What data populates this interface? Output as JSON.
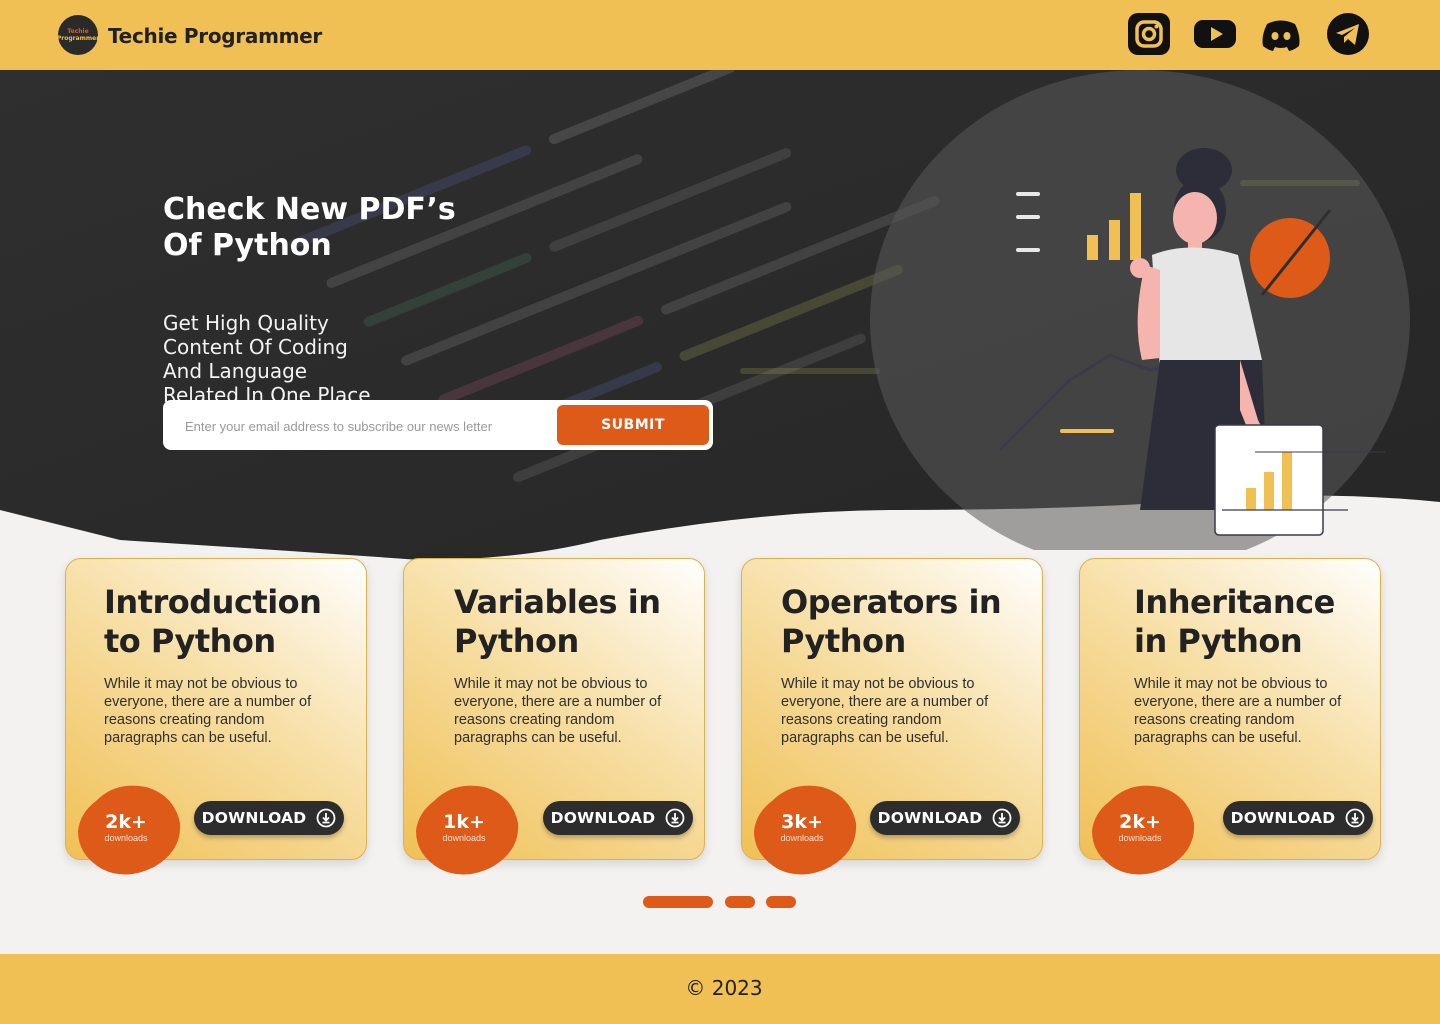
{
  "header": {
    "logo_text_line1": "Techie",
    "logo_text_line2": "Programmer",
    "brand": "Techie Programmer",
    "social": [
      "instagram-icon",
      "youtube-icon",
      "discord-icon",
      "telegram-icon"
    ]
  },
  "hero": {
    "title_line1": "Check New PDF’s",
    "title_line2": "Of  Python",
    "subtitle": [
      "Get High Quality",
      "Content Of Coding",
      "And Language",
      "Related In One Place"
    ],
    "email_placeholder": "Enter your email address to subscribe our news letter",
    "submit_label": "SUBMIT"
  },
  "cards": [
    {
      "title": "Introduction to Python",
      "body": "While it may not be obvious to everyone, there are a number of reasons creating random paragraphs can be useful.",
      "count": "2k+",
      "count_label": "downloads",
      "download_label": "DOWNLOAD"
    },
    {
      "title": "Variables in Python",
      "body": "While it may not be obvious to everyone, there are a number of reasons creating random paragraphs can be useful.",
      "count": "1k+",
      "count_label": "downloads",
      "download_label": "DOWNLOAD"
    },
    {
      "title": "Operators in Python",
      "body": "While it may not be obvious to everyone, there are a number of reasons creating random paragraphs can be useful.",
      "count": "3k+",
      "count_label": "downloads",
      "download_label": "DOWNLOAD"
    },
    {
      "title": "Inheritance in Python",
      "body": "While it may not be obvious to everyone, there are a number of reasons creating random paragraphs can be useful.",
      "count": "2k+",
      "count_label": "downloads",
      "download_label": "DOWNLOAD"
    }
  ],
  "carousel": {
    "pages": 3,
    "active": 1
  },
  "footer": {
    "copyright": "© 2023"
  },
  "colors": {
    "accent": "#f0c055",
    "orange": "#dd5a18",
    "dark": "#2b2b2b"
  }
}
